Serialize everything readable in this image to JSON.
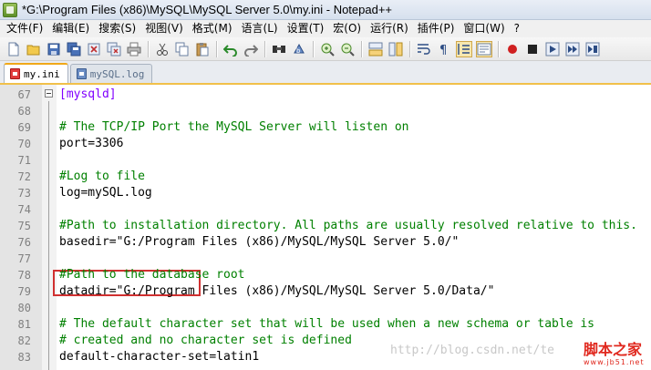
{
  "window": {
    "title": "*G:\\Program Files (x86)\\MySQL\\MySQL Server 5.0\\my.ini - Notepad++"
  },
  "menu": [
    {
      "label": "文件(F)",
      "name": "menu-file"
    },
    {
      "label": "编辑(E)",
      "name": "menu-edit"
    },
    {
      "label": "搜索(S)",
      "name": "menu-search"
    },
    {
      "label": "视图(V)",
      "name": "menu-view"
    },
    {
      "label": "格式(M)",
      "name": "menu-format"
    },
    {
      "label": "语言(L)",
      "name": "menu-language"
    },
    {
      "label": "设置(T)",
      "name": "menu-settings"
    },
    {
      "label": "宏(O)",
      "name": "menu-macro"
    },
    {
      "label": "运行(R)",
      "name": "menu-run"
    },
    {
      "label": "插件(P)",
      "name": "menu-plugins"
    },
    {
      "label": "窗口(W)",
      "name": "menu-window"
    },
    {
      "label": "?",
      "name": "menu-help"
    }
  ],
  "toolbar": {
    "buttons": [
      "new-file-icon",
      "open-file-icon",
      "save-icon",
      "save-all-icon",
      "close-icon",
      "close-all-icon",
      "print-icon",
      "cut-icon",
      "copy-icon",
      "paste-icon",
      "undo-icon",
      "redo-icon",
      "find-icon",
      "replace-icon",
      "zoom-in-icon",
      "zoom-out-icon",
      "sync-vertical-icon",
      "sync-horizontal-icon",
      "word-wrap-icon",
      "show-all-chars-icon",
      "indent-guide-icon",
      "folder-as-workspace-icon",
      "record-macro-icon",
      "stop-record-icon",
      "play-macro-icon",
      "run-macro-multiple-icon",
      "save-macro-icon"
    ]
  },
  "tabs": [
    {
      "label": "my.ini",
      "active": true
    },
    {
      "label": "mySQL.log",
      "active": false
    }
  ],
  "editor": {
    "lines": [
      {
        "num": "67",
        "text": "[mysqld]",
        "type": "section"
      },
      {
        "num": "68",
        "text": "",
        "type": "plain"
      },
      {
        "num": "69",
        "text": "# The TCP/IP Port the MySQL Server will listen on",
        "type": "comment"
      },
      {
        "num": "70",
        "text": "port=3306",
        "type": "plain"
      },
      {
        "num": "71",
        "text": "",
        "type": "plain"
      },
      {
        "num": "72",
        "text": "#Log to file",
        "type": "comment"
      },
      {
        "num": "73",
        "text": "log=mySQL.log",
        "type": "plain"
      },
      {
        "num": "74",
        "text": "",
        "type": "plain"
      },
      {
        "num": "75",
        "text": "#Path to installation directory. All paths are usually resolved relative to this.",
        "type": "comment"
      },
      {
        "num": "76",
        "text": "basedir=\"G:/Program Files (x86)/MySQL/MySQL Server 5.0/\"",
        "type": "plain"
      },
      {
        "num": "77",
        "text": "",
        "type": "plain"
      },
      {
        "num": "78",
        "text": "#Path to the database root",
        "type": "comment"
      },
      {
        "num": "79",
        "text": "datadir=\"G:/Program Files (x86)/MySQL/MySQL Server 5.0/Data/\"",
        "type": "plain"
      },
      {
        "num": "80",
        "text": "",
        "type": "plain"
      },
      {
        "num": "81",
        "text": "# The default character set that will be used when a new schema or table is",
        "type": "comment"
      },
      {
        "num": "82",
        "text": "# created and no character set is defined",
        "type": "comment"
      },
      {
        "num": "83",
        "text": "default-character-set=latin1",
        "type": "plain"
      }
    ]
  },
  "watermark": {
    "text": "http://blog.csdn.net/te",
    "brand": "脚本之家",
    "brand_sub": "www.jb51.net"
  },
  "colors": {
    "section": "#8000ff",
    "comment": "#008000",
    "highlight_box": "#d03030",
    "active_tab_accent": "#f0a818"
  }
}
